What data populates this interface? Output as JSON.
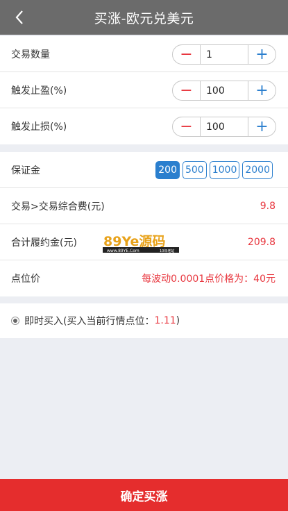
{
  "header": {
    "title": "买涨-欧元兑美元",
    "back_icon": "chevron-left-icon"
  },
  "trade_settings": {
    "quantity": {
      "label": "交易数量",
      "value": "1",
      "minus": "−",
      "plus": "+"
    },
    "take_profit": {
      "label": "触发止盈(%)",
      "value": "100",
      "minus": "−",
      "plus": "+"
    },
    "stop_loss": {
      "label": "触发止损(%)",
      "value": "100",
      "minus": "−",
      "plus": "+"
    }
  },
  "margin": {
    "label": "保证金",
    "options": [
      "200",
      "500",
      "1000",
      "2000"
    ],
    "selected": "200"
  },
  "fees": {
    "label": "交易>交易综合费(元)",
    "value": "9.8"
  },
  "total": {
    "label": "合计履约金(元)",
    "value": "209.8"
  },
  "watermark": {
    "main": "89Ye源码",
    "sub": "www.89YE.Com",
    "tag": "10年老站"
  },
  "point_price": {
    "label": "点位价",
    "value": "每波动0.0001点价格为：40元"
  },
  "buy_mode": {
    "label": "即时买入(买入当前行情点位：",
    "price": "1.11",
    "suffix": ")"
  },
  "confirm_button": "确定买涨",
  "colors": {
    "header_bg": "#6b6b6b",
    "accent_blue": "#2b7fce",
    "accent_red": "#e8373f",
    "confirm_bg": "#e52d2d"
  }
}
